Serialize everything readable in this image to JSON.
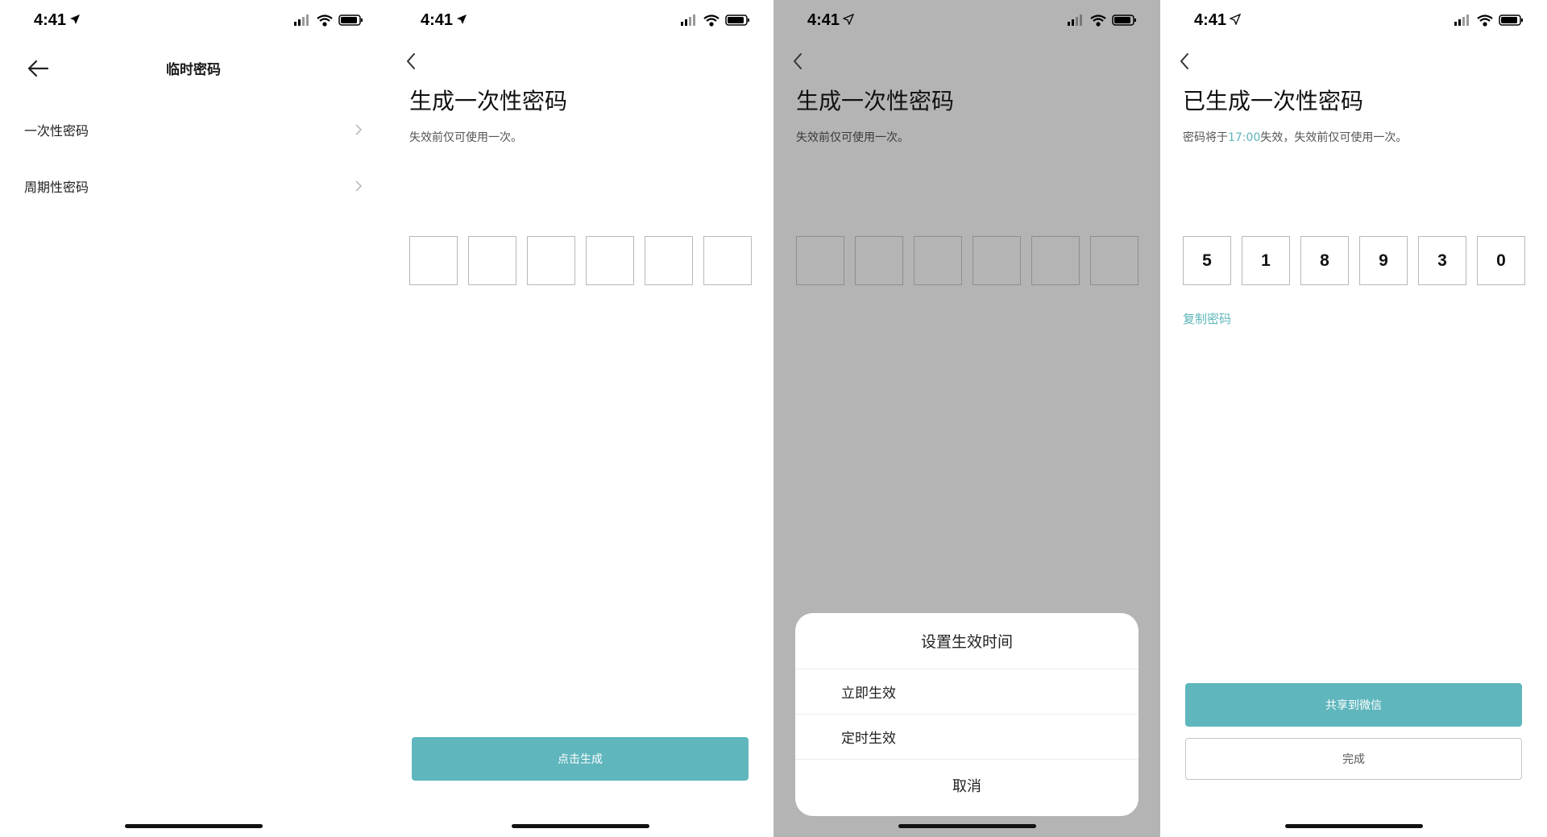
{
  "status": {
    "time": "4:41"
  },
  "screen1": {
    "title": "临时密码",
    "items": [
      {
        "label": "一次性密码"
      },
      {
        "label": "周期性密码"
      }
    ]
  },
  "screen2": {
    "title": "生成一次性密码",
    "subtitle": "失效前仅可使用一次。",
    "code": [
      "",
      "",
      "",
      "",
      "",
      ""
    ],
    "generate_button": "点击生成"
  },
  "screen3": {
    "title": "生成一次性密码",
    "subtitle": "失效前仅可使用一次。",
    "code": [
      "",
      "",
      "",
      "",
      "",
      ""
    ],
    "sheet": {
      "title": "设置生效时间",
      "options": [
        "立即生效",
        "定时生效"
      ],
      "cancel": "取消"
    }
  },
  "screen4": {
    "title": "已生成一次性密码",
    "subtitle_prefix": "密码将于",
    "expire_time": "17:00",
    "subtitle_suffix": "失效，失效前仅可使用一次。",
    "code": [
      "5",
      "1",
      "8",
      "9",
      "3",
      "0"
    ],
    "copy_link": "复制密码",
    "share_button": "共享到微信",
    "done_button": "完成"
  },
  "colors": {
    "accent": "#5fb6bd",
    "overlay": "#b4b4b4"
  }
}
